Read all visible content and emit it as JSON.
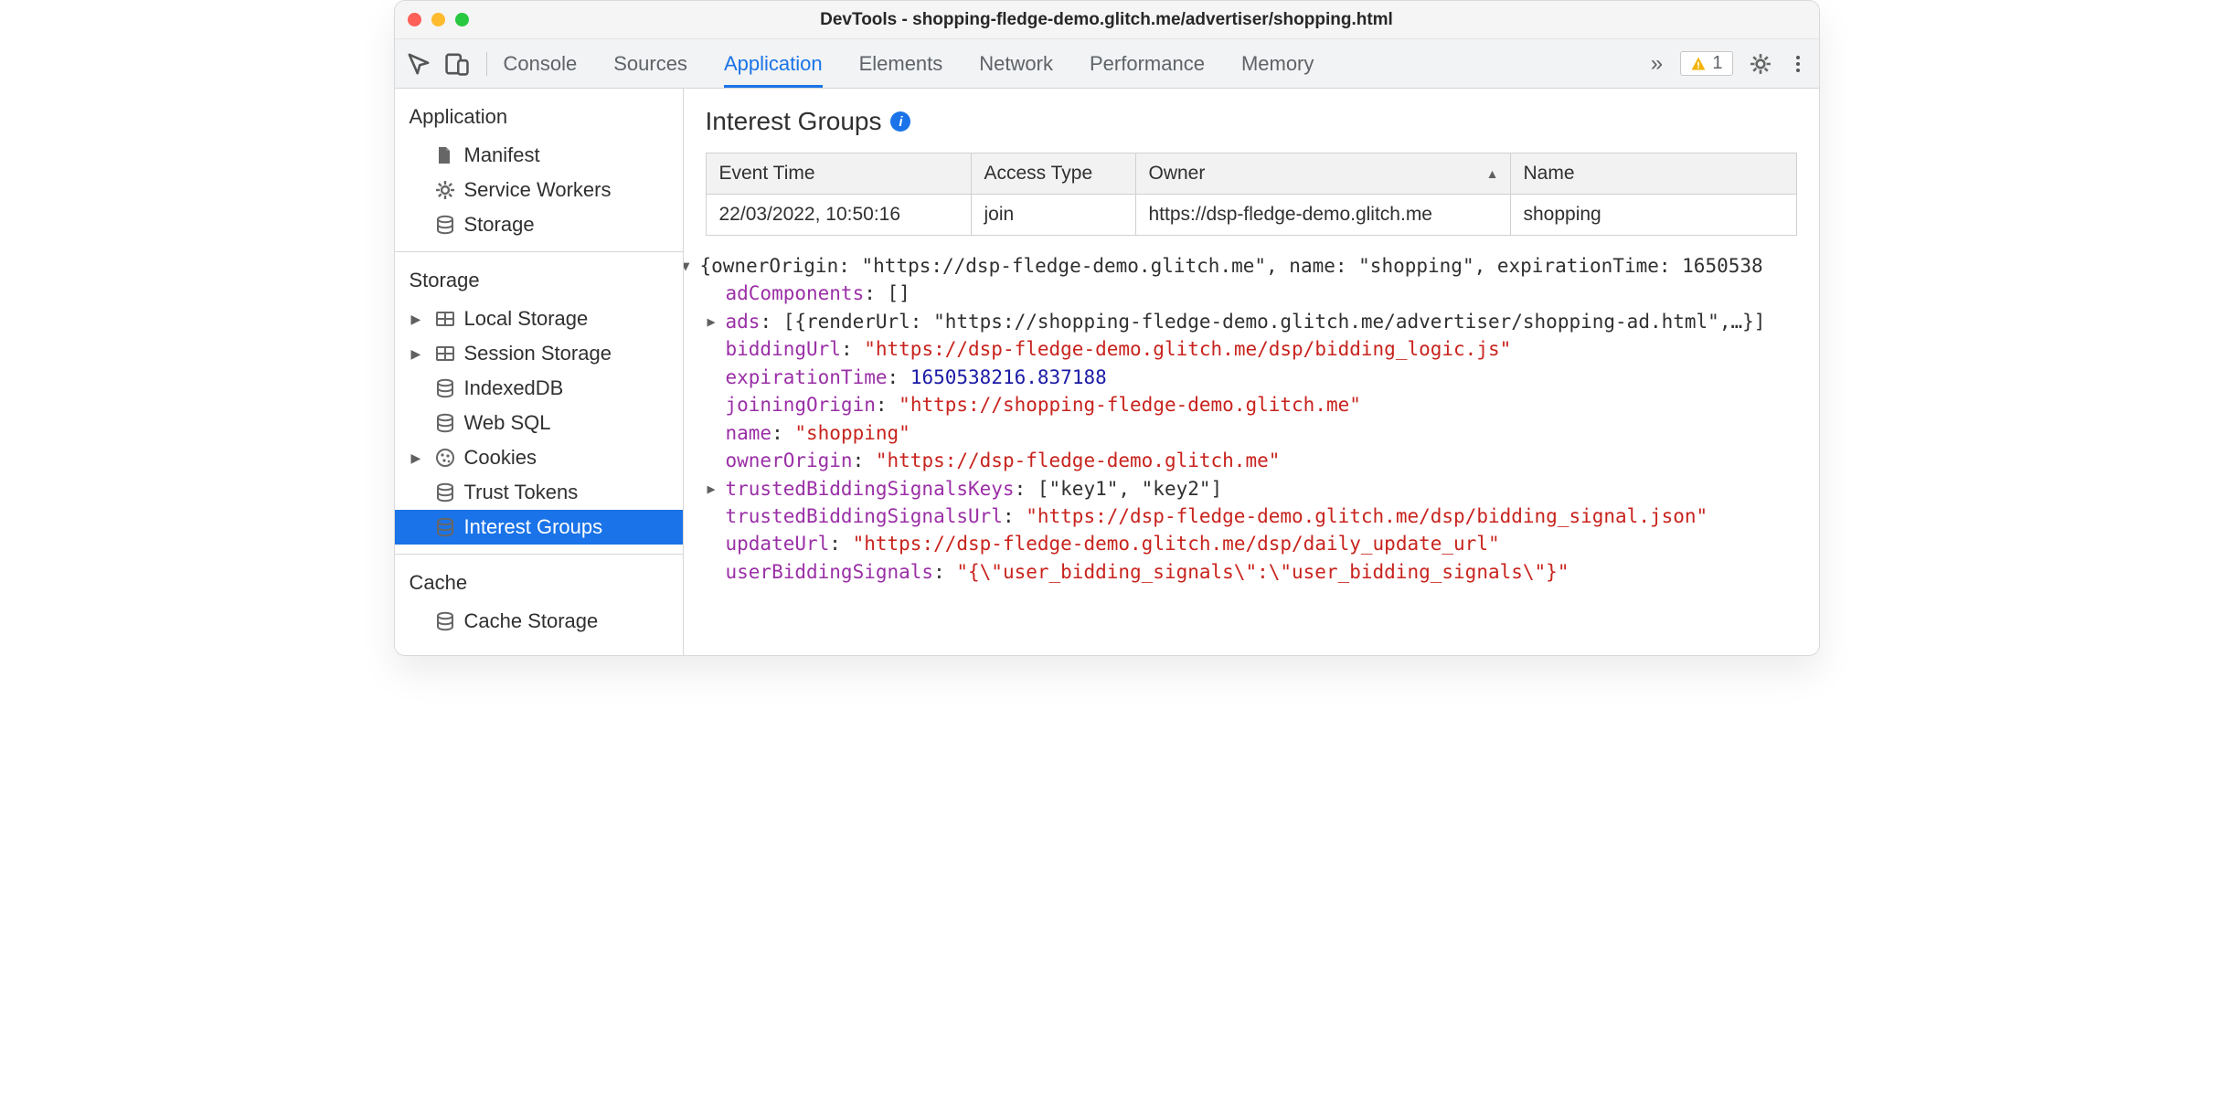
{
  "window": {
    "title": "DevTools - shopping-fledge-demo.glitch.me/advertiser/shopping.html"
  },
  "toolbar": {
    "tabs": [
      "Console",
      "Sources",
      "Application",
      "Elements",
      "Network",
      "Performance",
      "Memory"
    ],
    "active_tab": "Application",
    "warn_count": "1"
  },
  "sidebar": {
    "sections": [
      {
        "title": "Application",
        "items": [
          {
            "label": "Manifest",
            "icon": "file",
            "selected": false,
            "arrow": false
          },
          {
            "label": "Service Workers",
            "icon": "gear",
            "selected": false,
            "arrow": false
          },
          {
            "label": "Storage",
            "icon": "db",
            "selected": false,
            "arrow": false
          }
        ]
      },
      {
        "title": "Storage",
        "items": [
          {
            "label": "Local Storage",
            "icon": "grid",
            "selected": false,
            "arrow": true
          },
          {
            "label": "Session Storage",
            "icon": "grid",
            "selected": false,
            "arrow": true
          },
          {
            "label": "IndexedDB",
            "icon": "db",
            "selected": false,
            "arrow": false
          },
          {
            "label": "Web SQL",
            "icon": "db",
            "selected": false,
            "arrow": false
          },
          {
            "label": "Cookies",
            "icon": "cookie",
            "selected": false,
            "arrow": true
          },
          {
            "label": "Trust Tokens",
            "icon": "db",
            "selected": false,
            "arrow": false
          },
          {
            "label": "Interest Groups",
            "icon": "db",
            "selected": true,
            "arrow": false
          }
        ]
      },
      {
        "title": "Cache",
        "items": [
          {
            "label": "Cache Storage",
            "icon": "db",
            "selected": false,
            "arrow": false
          }
        ]
      }
    ]
  },
  "main_title": "Interest Groups",
  "table": {
    "headers": [
      "Event Time",
      "Access Type",
      "Owner",
      "Name"
    ],
    "sort_col": 2,
    "rows": [
      [
        "22/03/2022, 10:50:16",
        "join",
        "https://dsp-fledge-demo.glitch.me",
        "shopping"
      ]
    ]
  },
  "detail": {
    "top": "{ownerOrigin: \"https://dsp-fledge-demo.glitch.me\", name: \"shopping\", expirationTime: 1650538",
    "adComponents": "[]",
    "ads": "[{renderUrl: \"https://shopping-fledge-demo.glitch.me/advertiser/shopping-ad.html\",…}]",
    "biddingUrl": "\"https://dsp-fledge-demo.glitch.me/dsp/bidding_logic.js\"",
    "expirationTime": "1650538216.837188",
    "joiningOrigin": "\"https://shopping-fledge-demo.glitch.me\"",
    "name": "\"shopping\"",
    "ownerOrigin": "\"https://dsp-fledge-demo.glitch.me\"",
    "trustedBiddingSignalsKeys": "[\"key1\", \"key2\"]",
    "trustedBiddingSignalsUrl": "\"https://dsp-fledge-demo.glitch.me/dsp/bidding_signal.json\"",
    "updateUrl": "\"https://dsp-fledge-demo.glitch.me/dsp/daily_update_url\"",
    "userBiddingSignals": "\"{\\\"user_bidding_signals\\\":\\\"user_bidding_signals\\\"}\""
  }
}
